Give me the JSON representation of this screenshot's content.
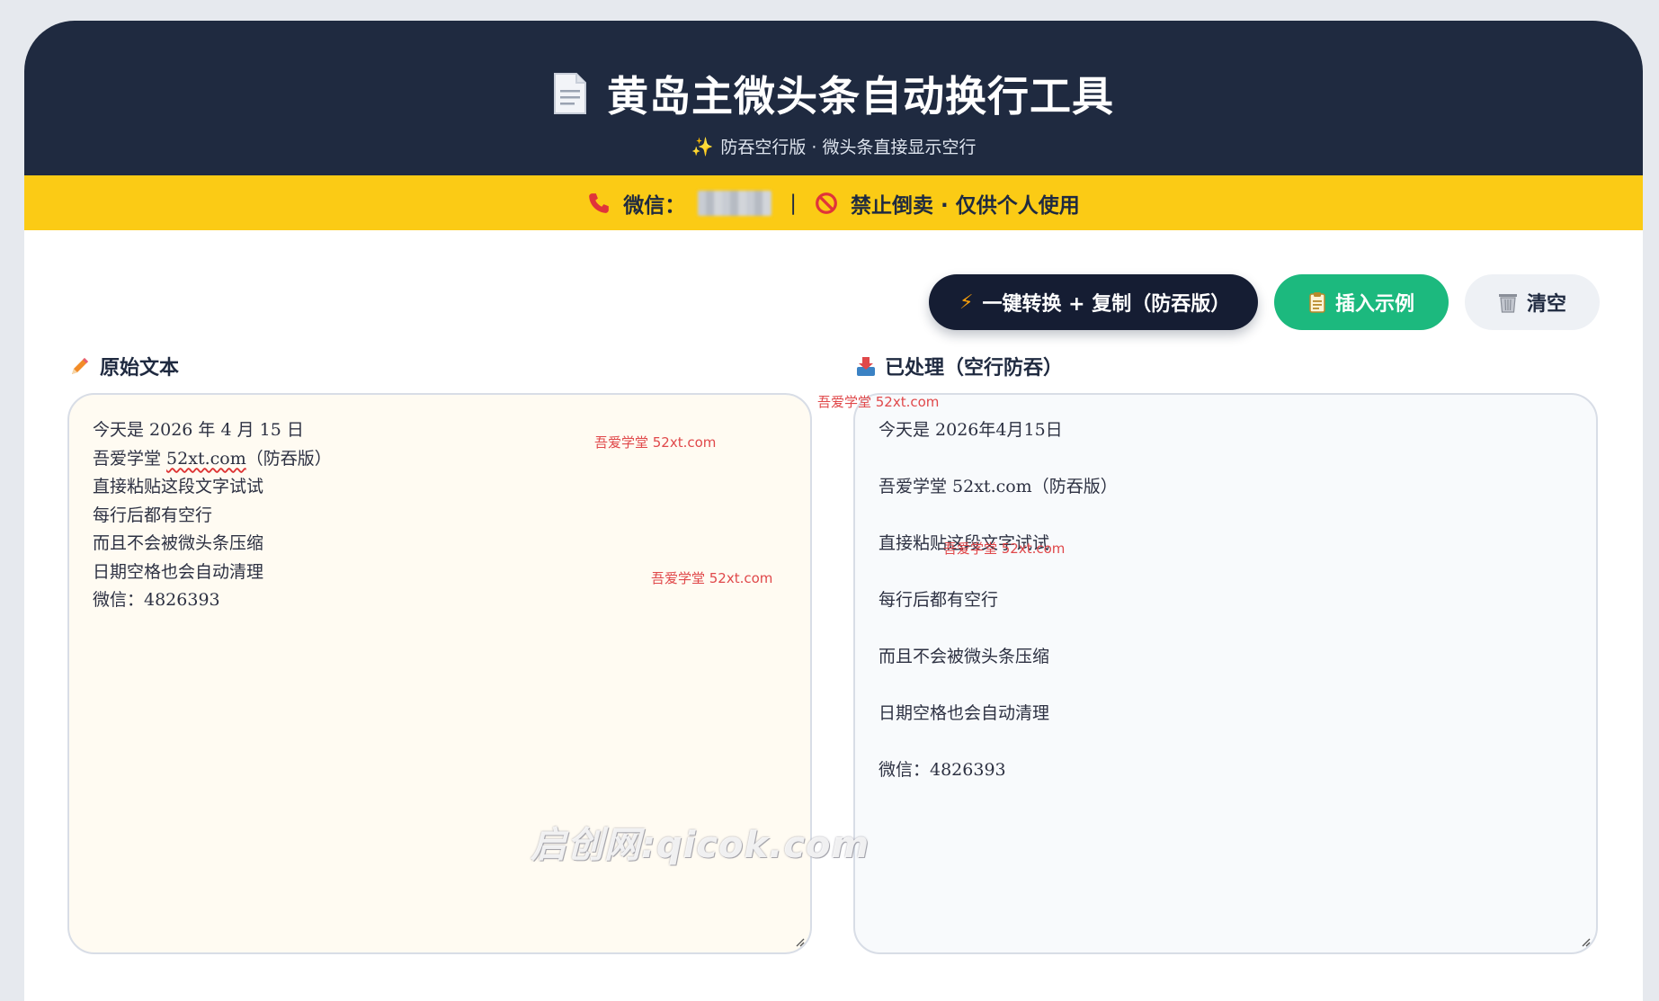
{
  "header": {
    "title": "黄岛主微头条自动换行工具",
    "subtitle": "防吞空行版 · 微头条直接显示空行"
  },
  "banner": {
    "wechat_label": "微信：",
    "separator": "|",
    "notice": "禁止倒卖 · 仅供个人使用"
  },
  "toolbar": {
    "convert_label": "一键转换 + 复制（防吞版）",
    "example_label": "插入示例",
    "clear_label": "清空"
  },
  "input_panel": {
    "label": "原始文本",
    "lines": [
      "今天是 2026 年 4 月 15 日",
      "吾爱学堂 ",
      "直接粘贴这段文字试试",
      "每行后都有空行",
      "而且不会被微头条压缩",
      "日期空格也会自动清理",
      "微信：4826393"
    ],
    "link_text": "52xt.com",
    "line2_suffix": "（防吞版）"
  },
  "output_panel": {
    "label": "已处理（空行防吞）",
    "lines": [
      "今天是 2026年4月15日",
      "吾爱学堂 52xt.com（防吞版）",
      "直接粘贴这段文字试试",
      "每行后都有空行",
      "而且不会被微头条压缩",
      "日期空格也会自动清理",
      "微信：4826393"
    ]
  },
  "watermarks": {
    "small": "吾爱学堂 52xt.com",
    "big": "启创网:qicok.com"
  },
  "colors": {
    "header_bg": "#1f2a40",
    "banner_bg": "#fbcb15",
    "convert_bg": "#151d33",
    "example_bg": "#1cb97e",
    "clear_bg": "#eef1f5"
  }
}
